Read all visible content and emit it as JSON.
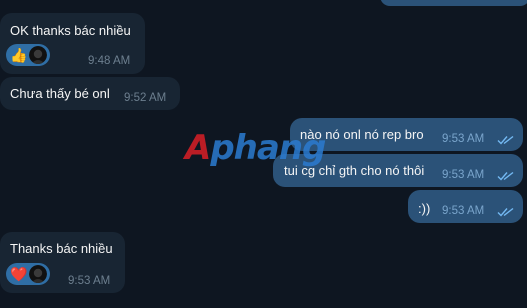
{
  "messages": [
    {
      "text": "OK thanks bác nhiều",
      "time": "9:48 AM",
      "reaction": "👍"
    },
    {
      "text": "Chưa thấy bé onl",
      "time": "9:52 AM"
    },
    {
      "text": "nào nó onl nó rep bro",
      "time": "9:53 AM",
      "status": "read"
    },
    {
      "text": "tui cg chỉ gth cho nó thôi",
      "time": "9:53 AM",
      "status": "read"
    },
    {
      "text": ":))",
      "time": "9:53 AM",
      "status": "read"
    },
    {
      "text": "Thanks bác nhiều",
      "time": "9:53 AM",
      "reaction": "❤️"
    }
  ],
  "watermark": {
    "first": "A",
    "rest": "phang"
  },
  "colors": {
    "background": "#0e1621",
    "incoming_bubble": "#182533",
    "outgoing_bubble": "#2b5278",
    "reaction_pill": "#2f6ea5",
    "read_ticks": "#73b8f2"
  }
}
